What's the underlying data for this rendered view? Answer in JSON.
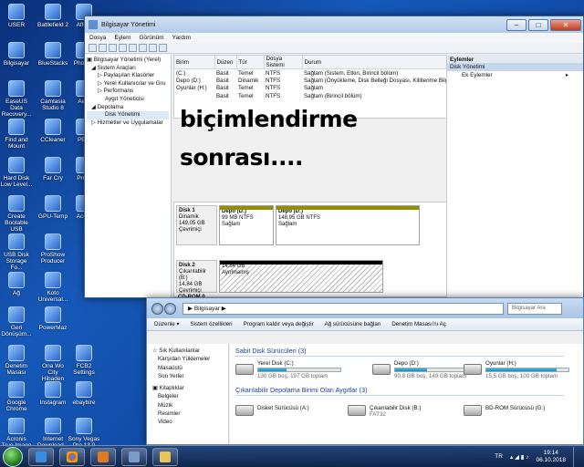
{
  "desktop": {
    "icons": [
      {
        "label": "USER"
      },
      {
        "label": "Battlefield 2"
      },
      {
        "label": "Bilgisayar"
      },
      {
        "label": "BlueStacks"
      },
      {
        "label": "EaseUS Data Recovery..."
      },
      {
        "label": "Camtasia Studio 8"
      },
      {
        "label": "Find and Mount"
      },
      {
        "label": "CCleaner"
      },
      {
        "label": "Hard Disk Low Level..."
      },
      {
        "label": "Far Cry"
      },
      {
        "label": "Create Bootable USB"
      },
      {
        "label": "GPU-Temp"
      },
      {
        "label": "USB Disk Storage Fo..."
      },
      {
        "label": "ProShow Producer"
      },
      {
        "label": "Ağ"
      },
      {
        "label": "Koto Universal..."
      },
      {
        "label": "Geri Dönüşüm..."
      },
      {
        "label": "PowerMaz"
      },
      {
        "label": "Denetim Masası"
      },
      {
        "label": "Ona Wo City Hibaden"
      },
      {
        "label": "Google Chrome"
      },
      {
        "label": "Instagram"
      },
      {
        "label": "Acronis True Image"
      },
      {
        "label": "Internet Download..."
      },
      {
        "label": "Affe..."
      },
      {
        "label": "Photo..."
      },
      {
        "label": "Ae..."
      },
      {
        "label": "PB..."
      },
      {
        "label": "Pro..."
      },
      {
        "label": "Ace..."
      },
      {
        "label": "FCB2 Settings"
      },
      {
        "label": "ebaybire"
      },
      {
        "label": "Sony Vegas Pro 13.0 Bir..."
      }
    ]
  },
  "computer_management": {
    "title": "Bilgisayar Yönetimi",
    "menu": [
      "Dosya",
      "Eylem",
      "Görünüm",
      "Yardım"
    ],
    "tree": [
      "Bilgisayar Yönetimi (Yerel)",
      "Sistem Araçları",
      "Paylaşılan Klasörler",
      "Yerel Kullanıcılar ve Gru",
      "Performans",
      "Aygıt Yöneticisi",
      "Depolama",
      "Disk Yönetimi",
      "Hizmetler ve Uygulamalar"
    ],
    "volume_table": {
      "headers": [
        "Birim",
        "Düzen",
        "Tür",
        "Dosya Sistemi",
        "Durum"
      ],
      "rows": [
        [
          "(C:)",
          "Basit",
          "Temel",
          "NTFS",
          "Sağlam (Sistem, Etkin, Birincil bölüm)"
        ],
        [
          "Depo (D:)",
          "Basit",
          "Dinamik",
          "NTFS",
          "Sağlam (Önyükleme, Disk Belleği Dosyası, Kilitlenme Bilgisi,"
        ],
        [
          "Oyunlar (H:)",
          "Basit",
          "Temel",
          "NTFS",
          "Sağlam"
        ],
        [
          "",
          "Basit",
          "Temel",
          "NTFS",
          "Sağlam (Birincil bölüm)"
        ]
      ]
    },
    "overlay_text": [
      "biçimlendirme",
      "sonrası...."
    ],
    "disk1": {
      "name": "Disk 1",
      "type": "Dinamik",
      "size": "149,05 GB",
      "status": "Çevrimiçi",
      "part1": {
        "name": "Depo (D:)",
        "size": "99 MB NTFS",
        "status": "Sağlam"
      },
      "part2": {
        "name": "Depo (D:)",
        "size": "148,95 GB NTFS",
        "status": "Sağlam"
      }
    },
    "disk2": {
      "name": "Disk 2",
      "type": "Çıkarılabilir (B:)",
      "size": "14,84 GB",
      "status": "Çevrimiçi",
      "part": {
        "size": "14,84 GB",
        "status": "Ayrılmamış"
      }
    },
    "cdrom": "CD-ROM 0",
    "actions": {
      "header": "Eylemler",
      "selected": "Disk Yönetimi",
      "more": "Ek Eylemler"
    }
  },
  "explorer": {
    "address": "Bilgisayar",
    "search_placeholder": "Bilgisayar Ara",
    "commands": [
      "Düzenle ▾",
      "Sistem özellikleri",
      "Program kaldır veya değiştir",
      "Ağ sürücüsüne bağlan",
      "Denetim Masası'nı Aç"
    ],
    "nav": {
      "favorites": "Sık Kullanılanlar",
      "fav_items": [
        "Karşıdan Yüklemeler",
        "Masaüstü",
        "Son Yerler"
      ],
      "libraries": "Kitaplıklar",
      "lib_items": [
        "Belgeler",
        "Müzik",
        "Resimler",
        "Video"
      ]
    },
    "group_fixed": "Sabit Disk Sürücüleri (3)",
    "fixed": [
      {
        "name": "Yerel Disk (C:)",
        "size": "130 GB boş, 197 GB toplam",
        "fill": 0.34
      },
      {
        "name": "Depo (D:)",
        "size": "90,8 GB boş, 149 GB toplam",
        "fill": 0.39
      },
      {
        "name": "Oyunlar (H:)",
        "size": "15,5 GB boş, 100 GB toplam",
        "fill": 0.85
      }
    ],
    "group_removable": "Çıkarılabilir Depolama Birimi Olan Aygıtlar (3)",
    "removable": [
      {
        "name": "Disket Sürücüsü (A:)",
        "sub": ""
      },
      {
        "name": "Çıkarılabilir Disk (B:)",
        "sub": "FAT32"
      },
      {
        "name": "BD-ROM Sürücüsü (G:)",
        "sub": ""
      }
    ]
  },
  "taskbar": {
    "lang": "TR",
    "time": "19:14",
    "date": "06.10.2018"
  },
  "colors": {
    "disk_dynamic_bar": "#8f8f00",
    "disk_unalloc_bar": "#000000",
    "highlight": "#dbe8f8"
  }
}
